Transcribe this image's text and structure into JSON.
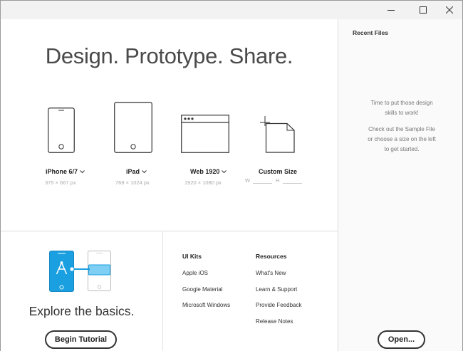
{
  "window": {
    "controls": {
      "minimize": "minimize-icon",
      "maximize": "maximize-icon",
      "close": "close-icon"
    }
  },
  "main": {
    "headline": "Design. Prototype. Share.",
    "devices": [
      {
        "label": "iPhone 6/7",
        "size": "375 × 667 px",
        "icon": "phone-icon"
      },
      {
        "label": "iPad",
        "size": "768 × 1024 px",
        "icon": "tablet-icon"
      },
      {
        "label": "Web 1920",
        "size": "1920 × 1080 px",
        "icon": "browser-window-icon"
      },
      {
        "label": "Custom Size",
        "width_label": "W",
        "height_label": "H",
        "icon": "custom-artboard-icon"
      }
    ],
    "explore_text": "Explore the basics.",
    "tutorial_button": "Begin Tutorial",
    "ui_kits": {
      "title": "UI Kits",
      "items": [
        "Apple iOS",
        "Google Material",
        "Microsoft Windows"
      ]
    },
    "resources": {
      "title": "Resources",
      "items": [
        "What's New",
        "Learn & Support",
        "Provide Feedback",
        "Release Notes"
      ]
    }
  },
  "recent": {
    "title": "Recent Files",
    "message_line1": "Time to put those design",
    "message_line2": "skills to work!",
    "message_line3": "Check out the Sample File",
    "message_line4": "or choose a size on the left",
    "message_line5": "to get started.",
    "open_button": "Open..."
  },
  "colors": {
    "accent": "#1a9fe0",
    "accent_light": "#7ecff3",
    "text": "#333333",
    "muted": "#aaaaaa"
  }
}
